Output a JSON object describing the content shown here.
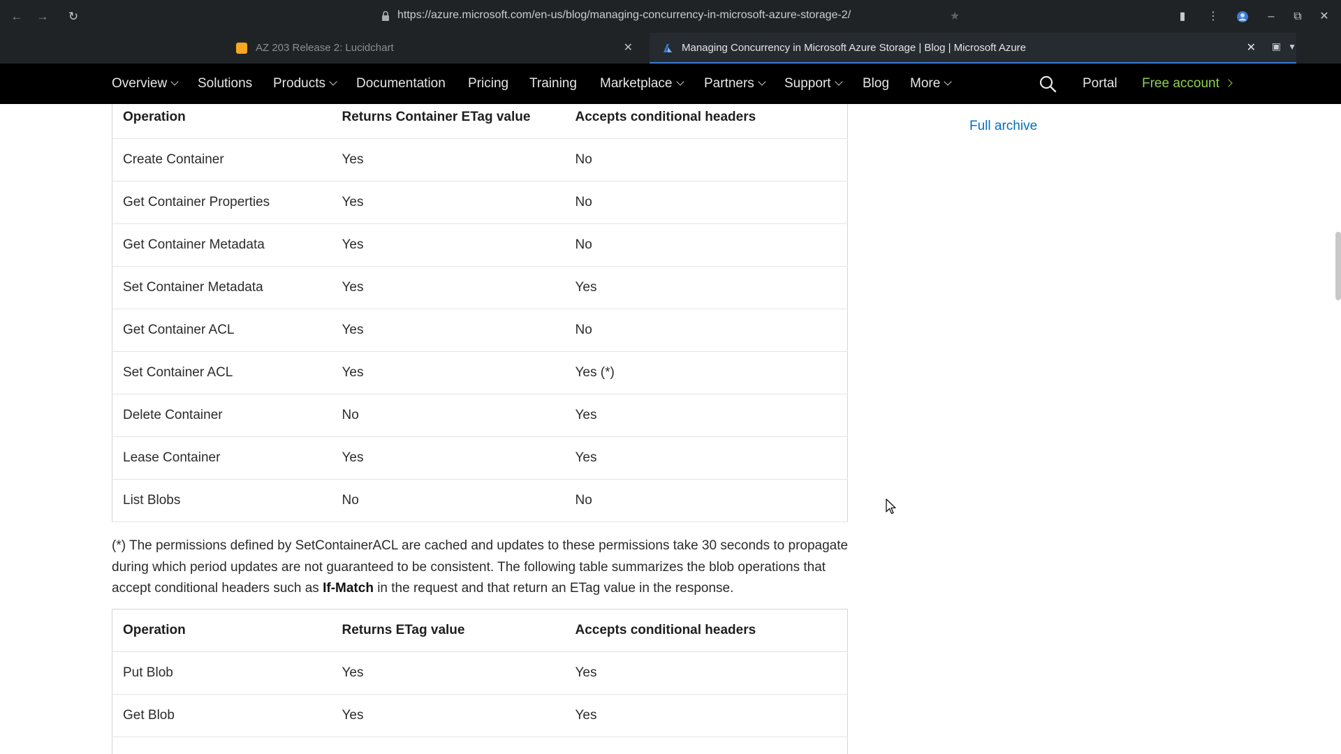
{
  "browser": {
    "url": "https://azure.microsoft.com/en-us/blog/managing-concurrency-in-microsoft-azure-storage-2/",
    "tabs": [
      {
        "title": "AZ 203 Release 2: Lucidchart",
        "favicon": "lucidchart-icon",
        "color": "#f6a623"
      },
      {
        "title": "Managing Concurrency in Microsoft Azure Storage | Blog | Microsoft Azure",
        "favicon": "azure-icon",
        "color": "#3a7bd5"
      }
    ]
  },
  "nav": {
    "overview": "Overview",
    "solutions": "Solutions",
    "products": "Products",
    "documentation": "Documentation",
    "pricing": "Pricing",
    "training": "Training",
    "marketplace": "Marketplace",
    "partners": "Partners",
    "support": "Support",
    "blog": "Blog",
    "more": "More",
    "portal": "Portal",
    "free_account": "Free account",
    "accent_color": "#8fd14f"
  },
  "sidebar": {
    "full_archive": "Full archive"
  },
  "table1": {
    "headers": [
      "Operation",
      "Returns Container ETag value",
      "Accepts conditional headers"
    ],
    "rows": [
      [
        "Create Container",
        "Yes",
        "No"
      ],
      [
        "Get Container Properties",
        "Yes",
        "No"
      ],
      [
        "Get Container Metadata",
        "Yes",
        "No"
      ],
      [
        "Set Container Metadata",
        "Yes",
        "Yes"
      ],
      [
        "Get Container ACL",
        "Yes",
        "No"
      ],
      [
        "Set Container ACL",
        "Yes",
        "Yes (*)"
      ],
      [
        "Delete Container",
        "No",
        "Yes"
      ],
      [
        "Lease Container",
        "Yes",
        "Yes"
      ],
      [
        "List Blobs",
        "No",
        "No"
      ]
    ]
  },
  "footnote": {
    "text_before": "(*) The permissions defined by SetContainerACL are cached and updates to these permissions take 30 seconds to propagate during which period updates are not guaranteed to be consistent. The following table summarizes the blob operations that accept conditional headers such as ",
    "bold": "If-Match",
    "text_after": " in the request and that return an ETag value in the response."
  },
  "table2": {
    "headers": [
      "Operation",
      "Returns ETag value",
      "Accepts conditional headers"
    ],
    "rows": [
      [
        "Put Blob",
        "Yes",
        "Yes"
      ],
      [
        "Get Blob",
        "Yes",
        "Yes"
      ],
      [
        "",
        "",
        ""
      ]
    ]
  }
}
